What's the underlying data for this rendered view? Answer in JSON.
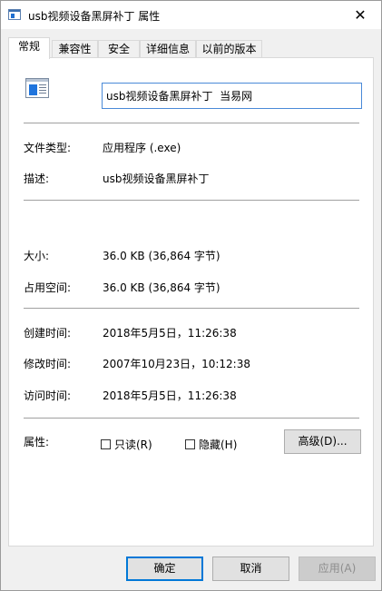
{
  "window": {
    "title": "usb视频设备黑屏补丁 属性",
    "close_glyph": "✕"
  },
  "tabs": [
    {
      "label": "常规",
      "active": true
    },
    {
      "label": "兼容性"
    },
    {
      "label": "安全"
    },
    {
      "label": "详细信息"
    },
    {
      "label": "以前的版本"
    }
  ],
  "general": {
    "file_name": "usb视频设备黑屏补丁  当易网",
    "file_icon": "exe-file-icon",
    "rows": {
      "type": {
        "label": "文件类型:",
        "value": "应用程序 (.exe)"
      },
      "desc": {
        "label": "描述:",
        "value": "usb视频设备黑屏补丁"
      },
      "size": {
        "label": "大小:",
        "value": "36.0 KB (36,864 字节)"
      },
      "disk": {
        "label": "占用空间:",
        "value": "36.0 KB (36,864 字节)"
      },
      "created": {
        "label": "创建时间:",
        "value": "2018年5月5日，11:26:38"
      },
      "modified": {
        "label": "修改时间:",
        "value": "2007年10月23日，10:12:38"
      },
      "accessed": {
        "label": "访问时间:",
        "value": "2018年5月5日，11:26:38"
      }
    },
    "attributes": {
      "label": "属性:",
      "readonly": {
        "label": "只读(R)",
        "checked": false
      },
      "hidden": {
        "label": "隐藏(H)",
        "checked": false
      },
      "advanced_button": "高级(D)..."
    }
  },
  "buttons": {
    "ok": "确定",
    "cancel": "取消",
    "apply": "应用(A)"
  },
  "colors": {
    "accent": "#0078d7",
    "input_border": "#4a8ad8"
  }
}
